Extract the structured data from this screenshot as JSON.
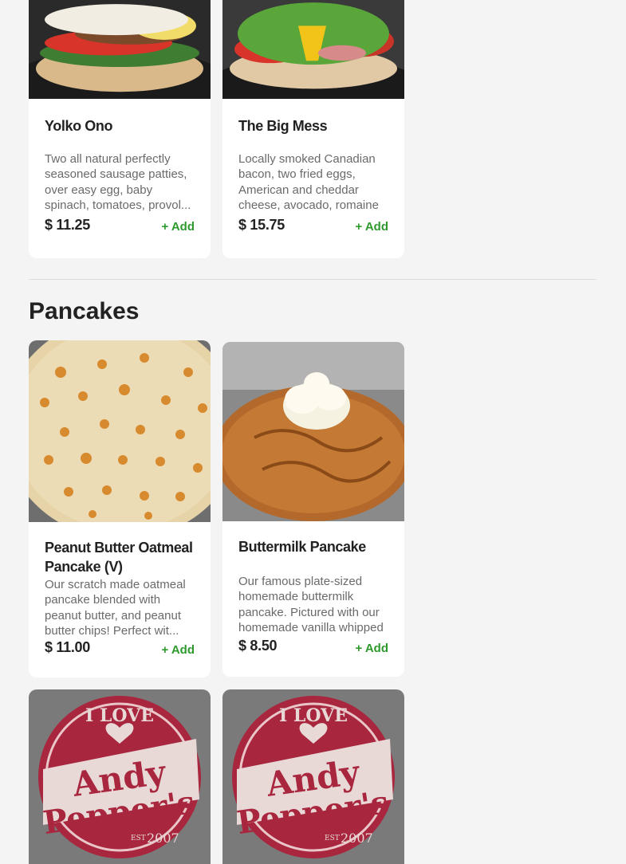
{
  "breakfast_items": [
    {
      "title": "Yolko Ono",
      "description": "Two all natural perfectly seasoned sausage patties, over easy egg, baby spinach, tomatoes, provol...",
      "price": "$ 11.25",
      "add_label": "+ Add"
    },
    {
      "title": "The Big Mess",
      "description": "Locally smoked Canadian bacon, two fried eggs, American and cheddar cheese, avocado, romaine let...",
      "price": "$ 15.75",
      "add_label": "+ Add"
    }
  ],
  "pancakes_section": {
    "title": "Pancakes",
    "items": [
      {
        "title": "Peanut Butter Oatmeal Pancake (V)",
        "description": "Our scratch made oatmeal pancake blended with peanut butter, and peanut butter chips! Perfect wit...",
        "price": "$ 11.00",
        "add_label": "+ Add"
      },
      {
        "title": "Buttermilk Pancake",
        "description": "Our famous plate-sized homemade buttermilk pancake. Pictured with our homemade vanilla whipped cr...",
        "price": "$ 8.50",
        "add_label": "+ Add"
      }
    ]
  },
  "logo": {
    "top_text": "I LOVE",
    "line1": "Andy",
    "line2": "Pepper's",
    "est": "EST",
    "year": "2007"
  }
}
